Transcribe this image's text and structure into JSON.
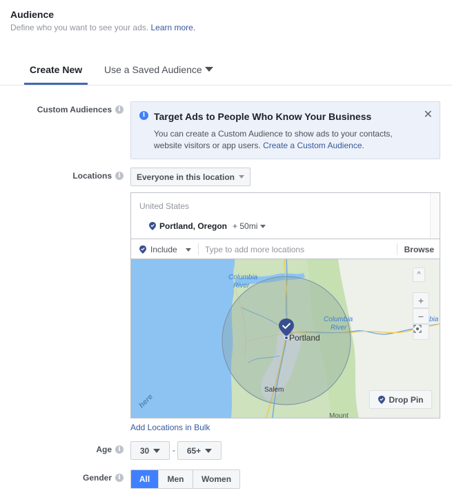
{
  "header": {
    "title": "Audience",
    "subtitle": "Define who you want to see your ads.",
    "learn_more": "Learn more."
  },
  "tabs": [
    {
      "label": "Create New",
      "active": true
    },
    {
      "label": "Use a Saved Audience",
      "active": false
    }
  ],
  "custom_audiences": {
    "label": "Custom Audiences",
    "banner": {
      "title": "Target Ads to People Who Know Your Business",
      "body": "You can create a Custom Audience to show ads to your contacts, website visitors or app users.",
      "link": "Create a Custom Audience",
      "link_suffix": "."
    }
  },
  "locations": {
    "label": "Locations",
    "audience_type": "Everyone in this location",
    "country": "United States",
    "selected": {
      "name": "Portland, Oregon",
      "radius": "+ 50mi"
    },
    "include_label": "Include",
    "input_placeholder": "Type to add more locations",
    "input_value": "",
    "browse_label": "Browse",
    "map": {
      "labels": {
        "portland": "Portland",
        "salem": "Salem",
        "columbia1_a": "Columbia",
        "columbia1_b": "River",
        "columbia2_a": "Columbia",
        "columbia2_b": "River",
        "columbia3": "bia",
        "mount": "Mount",
        "watermark": "here"
      },
      "controls": {
        "scroll_up": "^",
        "zoom_in": "+",
        "zoom_out": "−"
      },
      "drop_pin_label": "Drop Pin"
    },
    "bulk_link": "Add Locations in Bulk"
  },
  "age": {
    "label": "Age",
    "min": "30",
    "separator": "-",
    "max": "65+"
  },
  "gender": {
    "label": "Gender",
    "options": [
      "All",
      "Men",
      "Women"
    ],
    "selected": "All"
  },
  "colors": {
    "accent": "#4267b2",
    "link": "#365899",
    "selected_button": "#4080ff",
    "banner_bg": "#edf2fa",
    "pin": "#384f8f"
  }
}
